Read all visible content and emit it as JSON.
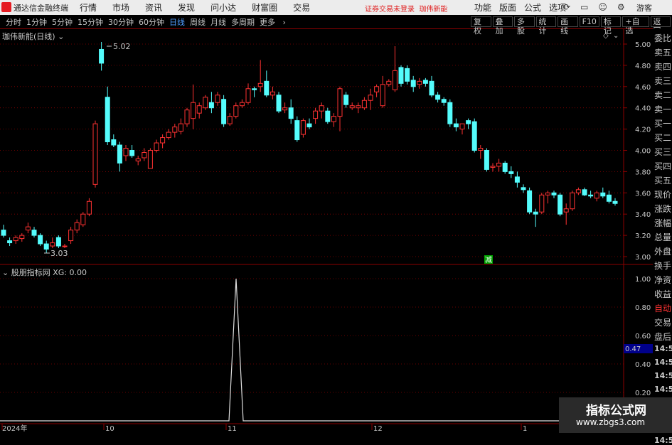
{
  "window": {
    "app_title": "通达信金融终端",
    "menu": [
      "行情",
      "市场",
      "资讯",
      "发现",
      "问小达",
      "财富圈",
      "交易"
    ],
    "warning": "证券交易未登录",
    "stock_name": "珈伟新能",
    "right_menu": [
      "功能",
      "版面",
      "公式",
      "选项"
    ],
    "guest": "游客"
  },
  "periods": [
    "分时",
    "1分钟",
    "5分钟",
    "15分钟",
    "30分钟",
    "60分钟",
    "日线",
    "周线",
    "月线",
    "多周期",
    "更多"
  ],
  "active_period": "日线",
  "tools": [
    "复权",
    "叠加",
    "多股",
    "统计",
    "画线",
    "F10",
    "标记",
    "+自选",
    "返回"
  ],
  "chart_title": "珈伟新能(日线)",
  "indicator_title": "股朋指标网 XG: 0.00",
  "price_axis": [
    "5.00",
    "4.80",
    "4.60",
    "4.40",
    "4.20",
    "4.00",
    "3.80",
    "3.60",
    "3.40",
    "3.20",
    "3.00"
  ],
  "ind_axis": [
    "1.00",
    "0.80",
    "0.60",
    "0.40",
    "0.20"
  ],
  "ind_value_badge": "0.47",
  "high_label": "5.02",
  "low_label": "3.03",
  "jian_marker": "减",
  "date_labels": [
    "2024年",
    "10",
    "11",
    "12",
    "1"
  ],
  "sidebar": [
    "委比",
    "卖五",
    "卖四",
    "卖三",
    "卖二",
    "卖一",
    "买一",
    "买二",
    "买三",
    "买四",
    "买五",
    "现价",
    "涨跌",
    "涨幅",
    "总量",
    "外盘",
    "换手",
    "净资",
    "收益",
    "自动",
    "交易",
    "盘后",
    "14:56",
    "14:56",
    "14:56",
    "14:56",
    "14:56",
    "14:56",
    "14:56",
    "14:56"
  ],
  "watermark": {
    "line1": "指标公式网",
    "line2": "www.zbgs3.com"
  },
  "colors": {
    "up": "#ff3232",
    "down": "#54fcfc",
    "bg": "#000000",
    "grid": "#8b0000"
  },
  "chart_data": {
    "type": "candlestick",
    "ylim": [
      3.0,
      5.0
    ],
    "candles": [
      [
        3.25,
        3.3,
        3.18,
        3.2
      ],
      [
        3.15,
        3.18,
        3.1,
        3.13
      ],
      [
        3.15,
        3.2,
        3.12,
        3.18
      ],
      [
        3.17,
        3.22,
        3.14,
        3.2
      ],
      [
        3.25,
        3.32,
        3.22,
        3.28
      ],
      [
        3.25,
        3.28,
        3.18,
        3.2
      ],
      [
        3.2,
        3.22,
        3.1,
        3.12
      ],
      [
        3.12,
        3.15,
        3.03,
        3.07
      ],
      [
        3.1,
        3.18,
        3.08,
        3.13
      ],
      [
        3.18,
        3.2,
        3.08,
        3.1
      ],
      [
        3.1,
        3.12,
        3.08,
        3.1
      ],
      [
        3.15,
        3.28,
        3.12,
        3.25
      ],
      [
        3.25,
        3.35,
        3.22,
        3.32
      ],
      [
        3.3,
        3.42,
        3.28,
        3.4
      ],
      [
        3.4,
        3.55,
        3.38,
        3.52
      ],
      [
        3.68,
        4.28,
        3.65,
        4.25
      ],
      [
        4.95,
        5.02,
        4.75,
        4.82
      ],
      [
        4.5,
        4.6,
        4.05,
        4.08
      ],
      [
        4.1,
        4.15,
        4.03,
        4.05
      ],
      [
        4.05,
        4.08,
        3.8,
        3.88
      ],
      [
        3.95,
        4.05,
        3.9,
        4.02
      ],
      [
        4.0,
        4.05,
        3.93,
        3.95
      ],
      [
        3.9,
        3.95,
        3.86,
        3.92
      ],
      [
        3.93,
        4.02,
        3.9,
        3.98
      ],
      [
        3.83,
        4.02,
        3.83,
        4.0
      ],
      [
        4.0,
        4.1,
        3.98,
        4.07
      ],
      [
        4.07,
        4.15,
        4.02,
        4.12
      ],
      [
        4.12,
        4.2,
        4.1,
        4.17
      ],
      [
        4.17,
        4.25,
        4.12,
        4.22
      ],
      [
        4.18,
        4.3,
        4.15,
        4.25
      ],
      [
        4.25,
        4.4,
        4.22,
        4.38
      ],
      [
        4.3,
        4.62,
        4.2,
        4.45
      ],
      [
        4.35,
        4.45,
        4.3,
        4.42
      ],
      [
        4.4,
        4.52,
        4.38,
        4.5
      ],
      [
        4.45,
        4.55,
        4.35,
        4.4
      ],
      [
        4.45,
        4.55,
        4.42,
        4.52
      ],
      [
        4.48,
        4.52,
        4.22,
        4.25
      ],
      [
        4.25,
        4.35,
        4.23,
        4.32
      ],
      [
        4.32,
        4.45,
        4.3,
        4.42
      ],
      [
        4.42,
        4.48,
        4.4,
        4.45
      ],
      [
        4.45,
        4.63,
        4.43,
        4.58
      ],
      [
        4.58,
        4.6,
        4.5,
        4.57
      ],
      [
        4.6,
        4.85,
        4.55,
        4.63
      ],
      [
        4.65,
        4.75,
        4.5,
        4.52
      ],
      [
        4.52,
        4.6,
        4.48,
        4.55
      ],
      [
        4.52,
        4.55,
        4.35,
        4.37
      ],
      [
        4.38,
        4.45,
        4.35,
        4.4
      ],
      [
        4.4,
        4.48,
        4.25,
        4.3
      ],
      [
        4.28,
        4.32,
        4.08,
        4.1
      ],
      [
        4.15,
        4.3,
        4.12,
        4.28
      ],
      [
        4.25,
        4.3,
        4.2,
        4.22
      ],
      [
        4.3,
        4.4,
        4.25,
        4.37
      ],
      [
        4.37,
        4.45,
        4.3,
        4.42
      ],
      [
        4.37,
        4.4,
        4.25,
        4.27
      ],
      [
        4.27,
        4.35,
        4.22,
        4.32
      ],
      [
        4.32,
        4.6,
        4.18,
        4.58
      ],
      [
        4.52,
        4.55,
        4.4,
        4.43
      ],
      [
        4.4,
        4.45,
        4.38,
        4.42
      ],
      [
        4.4,
        4.45,
        4.35,
        4.42
      ],
      [
        4.4,
        4.5,
        4.38,
        4.47
      ],
      [
        4.47,
        4.58,
        4.38,
        4.52
      ],
      [
        4.55,
        4.62,
        4.5,
        4.6
      ],
      [
        4.42,
        4.7,
        4.4,
        4.62
      ],
      [
        4.62,
        4.67,
        4.6,
        4.65
      ],
      [
        4.57,
        4.98,
        4.55,
        4.75
      ],
      [
        4.78,
        4.8,
        4.6,
        4.63
      ],
      [
        4.77,
        4.8,
        4.62,
        4.65
      ],
      [
        4.66,
        4.7,
        4.55,
        4.6
      ],
      [
        4.62,
        4.68,
        4.58,
        4.65
      ],
      [
        4.66,
        4.68,
        4.6,
        4.63
      ],
      [
        4.65,
        4.7,
        4.5,
        4.52
      ],
      [
        4.52,
        4.55,
        4.45,
        4.48
      ],
      [
        4.48,
        4.5,
        4.42,
        4.45
      ],
      [
        4.45,
        4.48,
        4.22,
        4.25
      ],
      [
        4.25,
        4.3,
        4.18,
        4.22
      ],
      [
        4.2,
        4.25,
        4.15,
        4.25
      ],
      [
        4.28,
        4.3,
        4.2,
        4.25
      ],
      [
        4.27,
        4.3,
        3.98,
        4.0
      ],
      [
        4.0,
        4.05,
        3.92,
        4.02
      ],
      [
        4.0,
        4.02,
        3.8,
        3.82
      ],
      [
        3.84,
        3.88,
        3.8,
        3.85
      ],
      [
        3.85,
        3.92,
        3.8,
        3.88
      ],
      [
        3.88,
        3.9,
        3.78,
        3.8
      ],
      [
        3.8,
        3.85,
        3.74,
        3.78
      ],
      [
        3.75,
        3.8,
        3.65,
        3.7
      ],
      [
        3.65,
        3.68,
        3.6,
        3.63
      ],
      [
        3.62,
        3.65,
        3.4,
        3.42
      ],
      [
        3.42,
        3.45,
        3.28,
        3.4
      ],
      [
        3.42,
        3.6,
        3.4,
        3.58
      ],
      [
        3.58,
        3.62,
        3.5,
        3.6
      ],
      [
        3.6,
        3.62,
        3.55,
        3.58
      ],
      [
        3.58,
        3.6,
        3.38,
        3.4
      ],
      [
        3.42,
        3.5,
        3.3,
        3.45
      ],
      [
        3.45,
        3.62,
        3.43,
        3.6
      ],
      [
        3.6,
        3.65,
        3.58,
        3.63
      ],
      [
        3.63,
        3.65,
        3.57,
        3.58
      ],
      [
        3.58,
        3.62,
        3.55,
        3.57
      ],
      [
        3.55,
        3.62,
        3.52,
        3.6
      ],
      [
        3.6,
        3.65,
        3.55,
        3.57
      ],
      [
        3.58,
        3.62,
        3.5,
        3.52
      ],
      [
        3.52,
        3.55,
        3.48,
        3.5
      ]
    ],
    "indicator": {
      "name": "XG",
      "spike_index": 44,
      "spike_value": 1.0,
      "ylim": [
        0,
        1.05
      ]
    }
  }
}
